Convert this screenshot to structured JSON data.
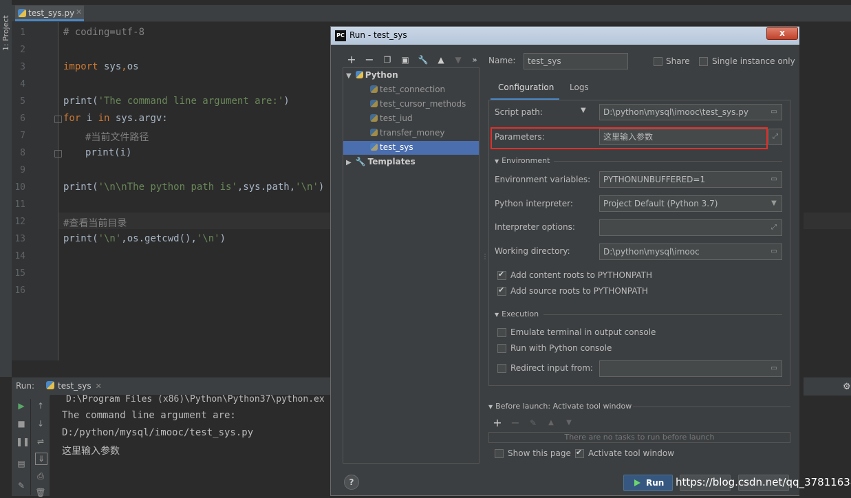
{
  "project_tab": "1: Project",
  "editor": {
    "tab_label": "test_sys.py",
    "line_numbers": [
      "1",
      "2",
      "3",
      "4",
      "5",
      "6",
      "7",
      "8",
      "9",
      "10",
      "11",
      "12",
      "13",
      "14",
      "15",
      "16"
    ]
  },
  "code": {
    "l1": "# coding=utf-8",
    "l3_kw": "import",
    "l3_rest": " sys",
    "l3_sep": ",",
    "l3_mod": "os",
    "l5_fn": "print(",
    "l5_str": "'The command line argument are:'",
    "l5_end": ")",
    "l6_kw1": "for",
    "l6_mid": " i ",
    "l6_kw2": "in",
    "l6_rest": " sys.argv:",
    "l7": "#当前文件路径",
    "l8": "print(i)",
    "l10_fn": "print(",
    "l10_str": "'\\n\\nThe python path is'",
    "l10_mid": ",sys.path,",
    "l10_str2": "'\\n'",
    "l10_end": ")",
    "l12": "#查看当前目录",
    "l13_fn": "print(",
    "l13_str": "'\\n'",
    "l13_mid": ",os.getcwd(),",
    "l13_str2": "'\\n'",
    "l13_end": ")"
  },
  "run_panel": {
    "label": "Run:",
    "tab": "test_sys",
    "output": [
      "D:\\Program Files (x86)\\Python\\Python37\\python.ex",
      "The command line argument are:",
      "D:/python/mysql/imooc/test_sys.py",
      "这里输入参数"
    ]
  },
  "dialog": {
    "title": "Run - test_sys",
    "logo": "PC",
    "close": "x",
    "tree": {
      "python_group": "Python",
      "items": [
        "test_connection",
        "test_cursor_methods",
        "test_iud",
        "transfer_money",
        "test_sys"
      ],
      "templates_group": "Templates"
    },
    "name_label": "Name:",
    "name_value": "test_sys",
    "share_label": "Share",
    "single_instance_label": "Single instance only",
    "tabs": [
      "Configuration",
      "Logs"
    ],
    "script_path_label": "Script path:",
    "script_path_value": "D:\\python\\mysql\\imooc\\test_sys.py",
    "parameters_label": "Parameters:",
    "parameters_value": "这里输入参数",
    "environment_header": "Environment",
    "env_vars_label": "Environment variables:",
    "env_vars_value": "PYTHONUNBUFFERED=1",
    "interpreter_label": "Python interpreter:",
    "interpreter_value": "Project Default (Python 3.7)",
    "interpreter_options_label": "Interpreter options:",
    "working_dir_label": "Working directory:",
    "working_dir_value": "D:\\python\\mysql\\imooc",
    "add_content_roots": "Add content roots to PYTHONPATH",
    "add_source_roots": "Add source roots to PYTHONPATH",
    "execution_header": "Execution",
    "emulate_terminal": "Emulate terminal in output console",
    "run_python_console": "Run with Python console",
    "redirect_input": "Redirect input from:",
    "before_launch": "Before launch: Activate tool window",
    "no_tasks": "There are no tasks to run before launch",
    "show_page": "Show this page",
    "activate_tool_window": "Activate tool window",
    "run_button": "Run",
    "help": "?"
  },
  "watermark": "https://blog.csdn.net/qq_37811638",
  "icons": [
    "python-file-icon",
    "run-icon",
    "stop-icon",
    "pause-icon",
    "up-arrow-icon",
    "down-arrow-icon",
    "wrap-icon",
    "scroll-end-icon",
    "print-icon",
    "pin-icon",
    "folder-icon",
    "expand-icon",
    "dropdown-icon",
    "gear-icon",
    "wrench-icon",
    "copy-icon",
    "save-icon",
    "plus-icon",
    "minus-icon"
  ],
  "accent_colors": {
    "selection": "#4b6eaf",
    "highlight_box": "#e0312b",
    "run_button": "#365880",
    "keyword": "#cc7832",
    "string": "#6a8759",
    "comment": "#808080"
  }
}
